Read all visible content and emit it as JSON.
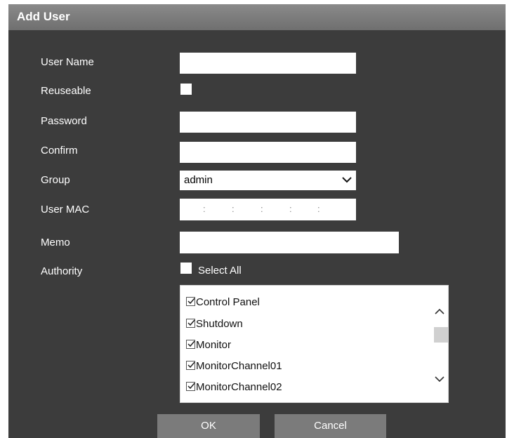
{
  "dialog": {
    "title": "Add User"
  },
  "form": {
    "user_name": {
      "label": "User Name",
      "value": ""
    },
    "reuseable": {
      "label": "Reuseable",
      "checked": false
    },
    "password": {
      "label": "Password",
      "value": ""
    },
    "confirm": {
      "label": "Confirm",
      "value": ""
    },
    "group": {
      "label": "Group",
      "selected": "admin"
    },
    "user_mac": {
      "label": "User MAC",
      "separators": [
        ":",
        ":",
        ":",
        ":",
        ":"
      ]
    },
    "memo": {
      "label": "Memo",
      "value": ""
    },
    "authority": {
      "label": "Authority",
      "select_all_label": "Select All",
      "select_all_checked": false,
      "items": [
        {
          "label": "Control Panel",
          "checked": true
        },
        {
          "label": "Shutdown",
          "checked": true
        },
        {
          "label": "Monitor",
          "checked": true
        },
        {
          "label": "MonitorChannel01",
          "checked": true
        },
        {
          "label": "MonitorChannel02",
          "checked": true
        }
      ]
    }
  },
  "buttons": {
    "ok": "OK",
    "cancel": "Cancel"
  },
  "icons": {
    "group_dropdown": "chevron-down-icon",
    "scroll_up": "chevron-up-icon",
    "scroll_down": "chevron-down-icon",
    "item_check": "checkmark-icon"
  },
  "colors": {
    "dialog_bg": "#3c3c3c",
    "titlebar": "#7d7d7d",
    "button_bg": "#7b7b7b",
    "text": "#ffffff"
  }
}
